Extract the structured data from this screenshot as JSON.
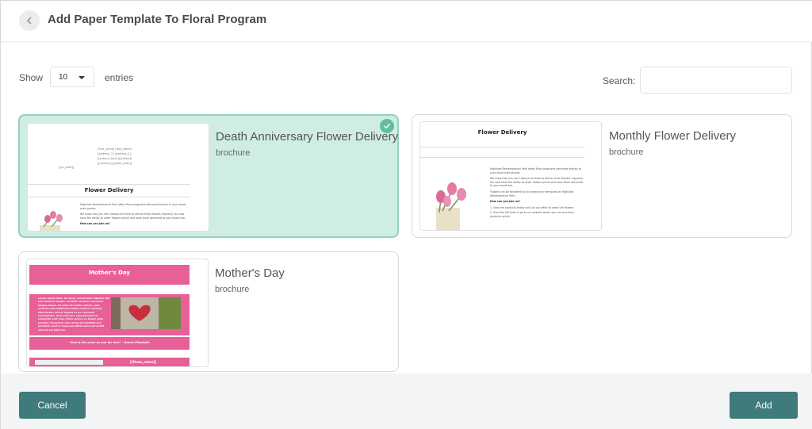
{
  "header": {
    "title": "Add Paper Template To Floral Program"
  },
  "controls": {
    "show_label": "Show",
    "entries_value": "10",
    "entries_label": "entries",
    "search_label": "Search:",
    "search_value": ""
  },
  "templates": [
    {
      "title": "Death Anniversary Flower Delivery",
      "type": "brochure",
      "selected": true,
      "preview": {
        "address_lines": [
          "[first_name] [last_name]",
          "[address_1] [address_2]",
          "[[suburb_town]] [[state]]",
          "[[country]] [[post_code]]"
        ],
        "small_code": "[[sc_code]]",
        "heading": "Flower Delivery",
        "para1": "Highview Remembrance Park offers floral programs delivered directly to your loved ones graves.",
        "para2": "We know that you can't always be there to deliver fresh flowers regularly. You now have the ability to order flowers online and have them delivered to your loved one.",
        "question": "How can you join us?"
      }
    },
    {
      "title": "Monthly Flower Delivery",
      "type": "brochure",
      "selected": false,
      "preview": {
        "heading": "Flower Delivery",
        "para1": "Highview Remembrance Park offers floral programs delivered directly to your loved ones graves.",
        "para2": "We know that you can't always be there to deliver fresh flowers regularly. You now have the ability to order flowers online and have them delivered to your loved one.",
        "para3": "Flowers can be delivered to all graves and memorials at Highview Remembrance Park.",
        "question": "How can you join us?",
        "step1": "1. View the products below and call our office to order the flowers.",
        "step2": "2. Scan the QR code to go to our website where you can purchase products online."
      }
    },
    {
      "title": "Mother's Day",
      "type": "brochure",
      "selected": false,
      "preview": {
        "heading": "Mother's Day",
        "body": "Lorem ipsum dolor sit amet, consectetur adipisci elit, sed eiusmod tempor incidunt ut labore et dolore magna aliqua. Ut enim ad minim veniam, quis nostrum exercitationem ullam corporis suscipit laboriosam, nisi ut aliquid ex ea commodi consequatur. Quis aute iure reprehenderit in voluptate velit esse cillum dolore eu fugiat nulla pariatur. Excepteur sint obcaecat cupiditat non proident, sunt in culpa qui officia deserunt mollit anim id est laborum.",
        "quote": "\"And is the price as you for love\" - Queen Elizabeth",
        "footer_code": "[[fham_name]]"
      }
    }
  ],
  "footer": {
    "cancel_label": "Cancel",
    "add_label": "Add"
  },
  "colors": {
    "accent": "#3e7b7a",
    "selected_bg": "#cfede4",
    "selected_border": "#8fd4bf",
    "check": "#5fbfa0",
    "pink": "#e86098"
  }
}
